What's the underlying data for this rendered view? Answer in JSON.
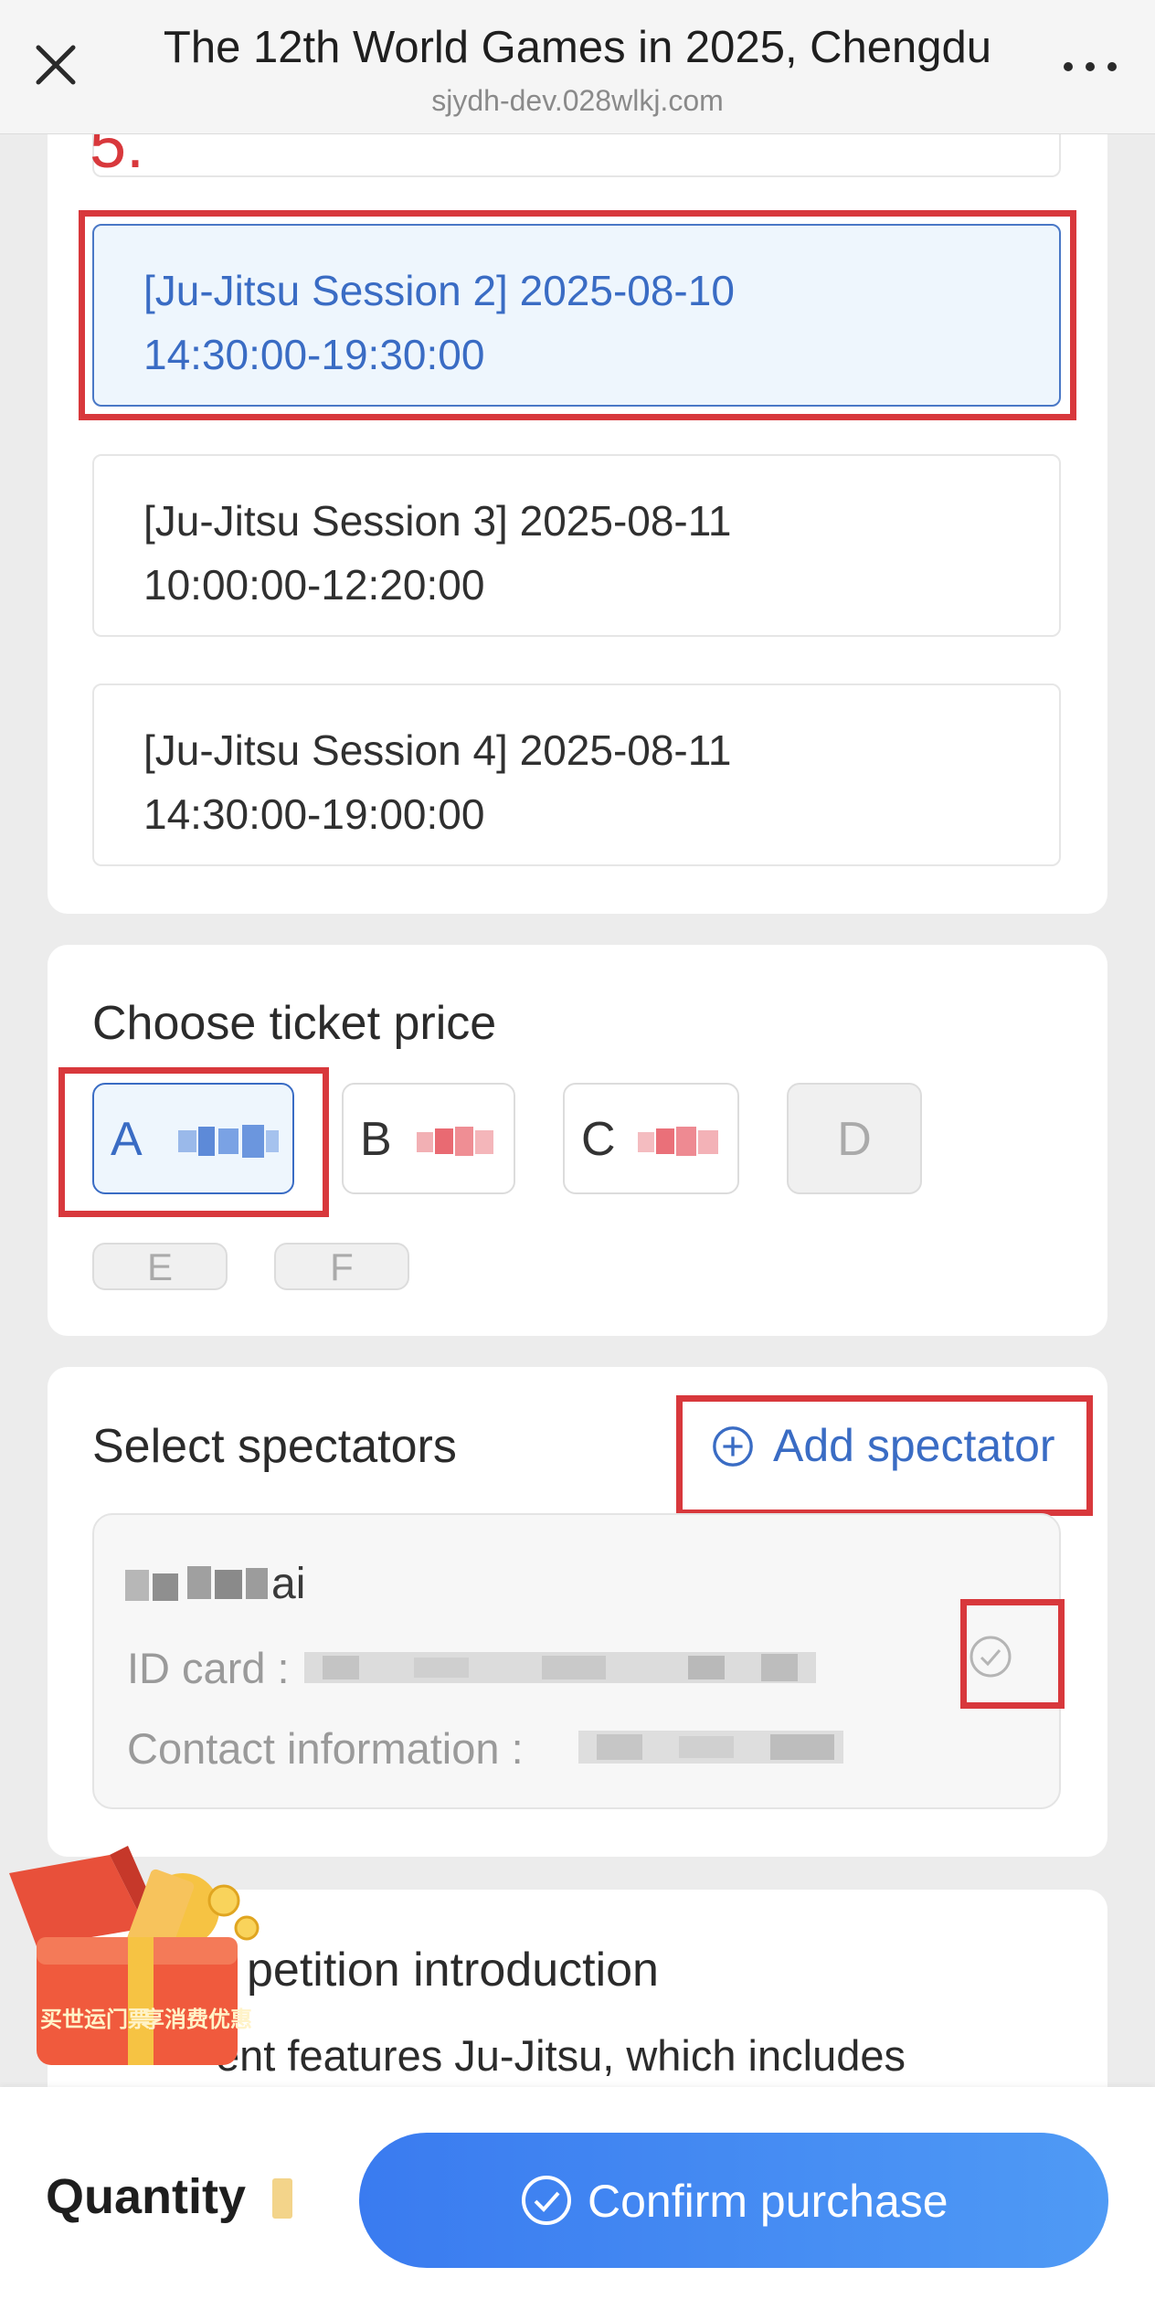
{
  "header": {
    "title": "The 12th World Games in 2025, Chengdu",
    "url": "sjydh-dev.028wlkj.com"
  },
  "step_label": "5.",
  "sessions": [
    {
      "line1": "[Ju-Jitsu Session 2] 2025-08-10",
      "line2": "14:30:00-19:30:00",
      "selected": true
    },
    {
      "line1": "[Ju-Jitsu Session 3] 2025-08-11",
      "line2": "10:00:00-12:20:00",
      "selected": false
    },
    {
      "line1": "[Ju-Jitsu Session 4] 2025-08-11",
      "line2": "14:30:00-19:00:00",
      "selected": false
    }
  ],
  "ticket_price": {
    "title": "Choose ticket price",
    "options": [
      "A",
      "B",
      "C",
      "D",
      "E",
      "F"
    ]
  },
  "spectators": {
    "title": "Select spectators",
    "add_label": "Add spectator",
    "card": {
      "name_suffix": "ai",
      "id_label": "ID card :",
      "contact_label": "Contact information :"
    }
  },
  "competition": {
    "title": "petition introduction",
    "text": "ent features Ju-Jitsu, which includes"
  },
  "promo": {
    "line1": "买世运门票",
    "line2": "享消费优惠"
  },
  "bottom": {
    "quantity_label": "Quantity",
    "confirm_label": "Confirm purchase"
  },
  "colors": {
    "accent": "#3a6cc4",
    "annotation_red": "#d8383c",
    "button_gradient_start": "#3a7bf0",
    "button_gradient_end": "#4f9af5"
  },
  "icons": [
    "close-icon",
    "more-icon",
    "add-circle-icon",
    "check-circle-icon",
    "confirm-check-icon",
    "gift-box-icon"
  ]
}
